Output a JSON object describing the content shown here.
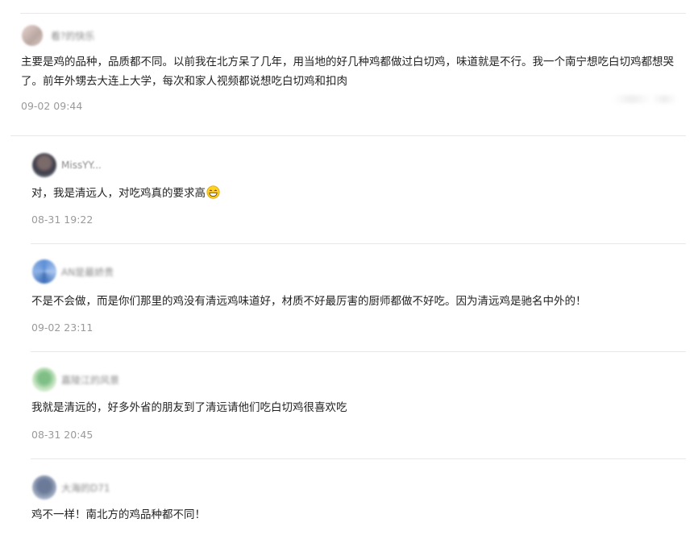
{
  "colors": {
    "text": "#222222",
    "meta": "#9a9a9a",
    "divider": "#e8e8e8",
    "emoji_face": "#ffd21f"
  },
  "comments": [
    {
      "username": "看?的快乐",
      "text": "主要是鸡的品种，品质都不同。以前我在北方呆了几年，用当地的好几种鸡都做过白切鸡，味道就是不行。我一个南宁想吃白切鸡都想哭了。前年外甥去大连上大学，每次和家人视频都说想吃白切鸡和扣肉",
      "time": "09-02 09:44"
    },
    {
      "username": "MissYY...",
      "text": "对，我是清远人，对吃鸡真的要求高",
      "emoji": "grin-emoji",
      "time": "08-31 19:22"
    },
    {
      "username": "AN是最娇贵",
      "text": "不是不会做，而是你们那里的鸡没有清远鸡味道好，材质不好最厉害的厨师都做不好吃。因为清远鸡是驰名中外的！",
      "time": "09-02 23:11"
    },
    {
      "username": "嘉陵江的风景",
      "text": "我就是清远的，好多外省的朋友到了清远请他们吃白切鸡很喜欢吃",
      "time": "08-31 20:45"
    },
    {
      "username": "大海的D71",
      "text": "鸡不一样！南北方的鸡品种都不同！",
      "time": ""
    }
  ]
}
